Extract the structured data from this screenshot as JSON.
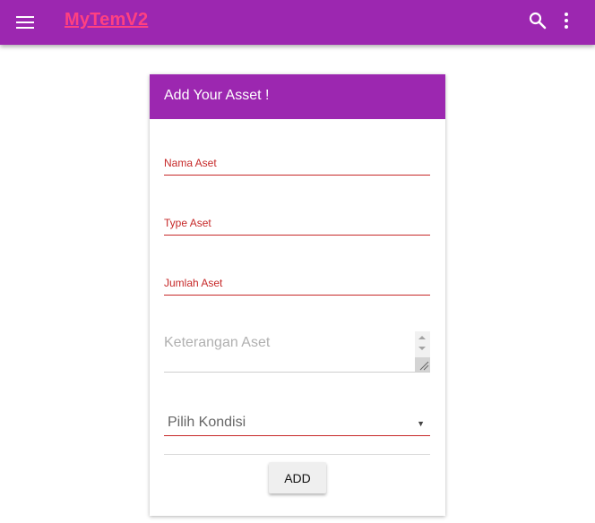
{
  "appbar": {
    "title": "MyTemV2",
    "menu_icon": "menu-icon",
    "search_icon": "search-icon",
    "more_icon": "more-vert-icon",
    "background_color": "#9c27b0",
    "title_color": "#ff4081"
  },
  "form": {
    "title": "Add Your Asset !",
    "fields": [
      {
        "label": "Nama Aset",
        "value": ""
      },
      {
        "label": "Type Aset",
        "value": ""
      },
      {
        "label": "Jumlah Aset",
        "value": ""
      }
    ],
    "keterangan_placeholder": "Keterangan Aset",
    "kondisi_select": "Pilih Kondisi",
    "add_button": "ADD",
    "field_line_color": "#c62828"
  }
}
